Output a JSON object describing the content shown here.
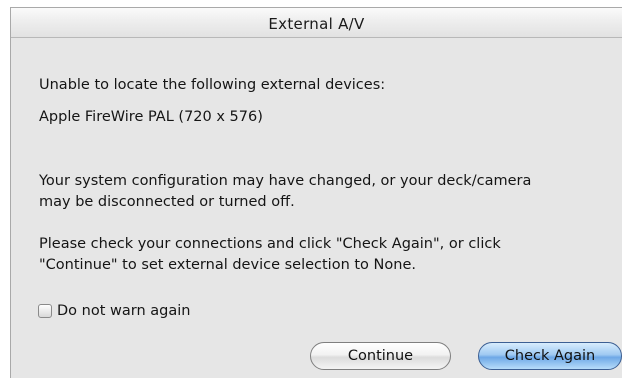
{
  "window": {
    "title": "External A/V"
  },
  "message": {
    "line1": "Unable to locate the following external devices:",
    "device": "Apple FireWire PAL (720 x 576)",
    "para1": "Your system configuration may have changed, or your deck/camera\nmay be disconnected or turned off.",
    "para2": "Please check your connections and click \"Check Again\", or click\n\"Continue\" to set external device selection to None."
  },
  "checkbox": {
    "label": "Do not warn again",
    "checked": false
  },
  "buttons": {
    "continue_label": "Continue",
    "check_again_label": "Check Again"
  },
  "colors": {
    "default_button": "#9fc9f2",
    "dialog_background": "#e6e6e6"
  }
}
